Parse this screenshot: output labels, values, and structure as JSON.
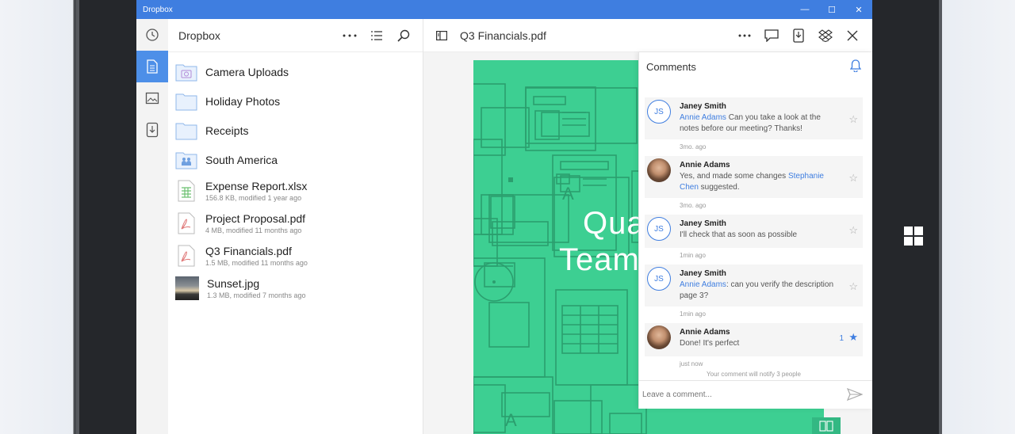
{
  "app": {
    "title": "Dropbox"
  },
  "titlebar": {
    "minimize": "—",
    "maximize": "☐",
    "close": "✕"
  },
  "rail": {
    "items": [
      {
        "icon": "clock-icon",
        "active": false
      },
      {
        "icon": "document-icon",
        "active": true
      },
      {
        "icon": "photo-icon",
        "active": false
      },
      {
        "icon": "offline-icon",
        "active": false
      }
    ]
  },
  "file_pane": {
    "title": "Dropbox",
    "folders": [
      {
        "name": "Camera Uploads",
        "icon": "camera-folder-icon"
      },
      {
        "name": "Holiday Photos",
        "icon": "folder-icon"
      },
      {
        "name": "Receipts",
        "icon": "folder-icon"
      },
      {
        "name": "South America",
        "icon": "shared-folder-icon"
      }
    ],
    "files": [
      {
        "name": "Expense Report.xlsx",
        "meta": "156.8 KB, modified 1 year ago",
        "icon": "spreadsheet-icon"
      },
      {
        "name": "Project Proposal.pdf",
        "meta": "4 MB, modified 11 months ago",
        "icon": "pdf-icon"
      },
      {
        "name": "Q3 Financials.pdf",
        "meta": "1.5 MB, modified 11 months ago",
        "icon": "pdf-icon"
      },
      {
        "name": "Sunset.jpg",
        "meta": "1.3 MB, modified 7 months ago",
        "icon": "image-thumb"
      }
    ]
  },
  "doc_pane": {
    "title": "Q3 Financials.pdf",
    "cover_line1": "Qua",
    "cover_line2": "Team"
  },
  "comments": {
    "title": "Comments",
    "items": [
      {
        "initials": "JS",
        "author": "Janey Smith",
        "mention": "Annie Adams",
        "text": " Can you take a look at the notes before our meeting? Thanks!",
        "mention2": "",
        "text2": "",
        "time": "3mo. ago",
        "star_count": "",
        "starred": false
      },
      {
        "initials": "",
        "author": "Annie Adams",
        "mention": "",
        "text": "Yes, and made some changes ",
        "mention2": "Stephanie Chen",
        "text2": " suggested.",
        "time": "3mo. ago",
        "star_count": "",
        "starred": false
      },
      {
        "initials": "JS",
        "author": "Janey Smith",
        "mention": "",
        "text": "I'll check that as soon as possible",
        "mention2": "",
        "text2": "",
        "time": "1min ago",
        "star_count": "",
        "starred": false
      },
      {
        "initials": "JS",
        "author": "Janey Smith",
        "mention": "Annie Adams",
        "text": ": can you verify the description page 3?",
        "mention2": "",
        "text2": "",
        "time": "1min ago",
        "star_count": "",
        "starred": false
      },
      {
        "initials": "",
        "author": "Annie Adams",
        "mention": "",
        "text": "Done! It's perfect",
        "mention2": "",
        "text2": "",
        "time": "just now",
        "star_count": "1",
        "starred": true
      }
    ],
    "notify": "Your comment will notify 3 people",
    "input_placeholder": "Leave a comment..."
  },
  "colors": {
    "accent": "#3f7ee0",
    "page_green": "#3dcf92"
  }
}
